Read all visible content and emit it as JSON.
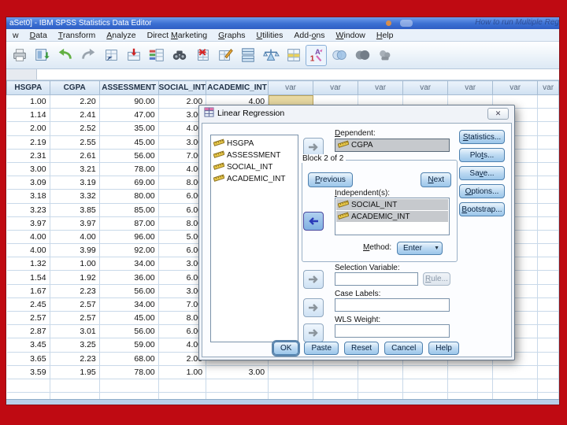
{
  "colors": {
    "frame_red": "#bf0a12",
    "titlebar_blue": "#3a6fd2",
    "selection_yellow": "#e8d9a2",
    "button_blue": "#bcd9f2",
    "selected_item_gray": "#c6c9cd"
  },
  "window": {
    "title": "aSet0] - IBM SPSS Statistics Data Editor",
    "titlebar_overlay": "How to run Multiple Reg",
    "menus": [
      {
        "label": "w"
      },
      {
        "label": "Data",
        "u": 0
      },
      {
        "label": "Transform",
        "u": 0
      },
      {
        "label": "Analyze",
        "u": 0
      },
      {
        "label": "Direct Marketing",
        "u": 7
      },
      {
        "label": "Graphs",
        "u": 0
      },
      {
        "label": "Utilities",
        "u": 0
      },
      {
        "label": "Add-ons",
        "u": 4
      },
      {
        "label": "Window",
        "u": 0
      },
      {
        "label": "Help",
        "u": 0
      }
    ]
  },
  "toolbar": {
    "icons": [
      "print",
      "open-recent-dialogs",
      "undo",
      "redo",
      "goto-case",
      "goto-variable",
      "variables",
      "find",
      "insert-cases",
      "insert-variable",
      "split-file",
      "weight-cases",
      "value-labels",
      "use-variable-sets",
      "show-variable-sets",
      "show-all-variables",
      "spell-check"
    ]
  },
  "grid": {
    "columns": [
      "HSGPA",
      "CGPA",
      "ASSESSMENT",
      "SOCIAL_INT",
      "ACADEMIC_INT",
      "var",
      "var",
      "var",
      "var",
      "var",
      "var",
      "var"
    ],
    "selection": {
      "row": 1,
      "column": 6
    },
    "rows": [
      [
        "1.00",
        "2.20",
        "90.00",
        "2.00",
        "4.00"
      ],
      [
        "1.14",
        "2.41",
        "47.00",
        "3.00",
        ""
      ],
      [
        "2.00",
        "2.52",
        "35.00",
        "4.00",
        ""
      ],
      [
        "2.19",
        "2.55",
        "45.00",
        "3.00",
        ""
      ],
      [
        "2.31",
        "2.61",
        "56.00",
        "7.00",
        ""
      ],
      [
        "3.00",
        "3.21",
        "78.00",
        "4.00",
        ""
      ],
      [
        "3.09",
        "3.19",
        "69.00",
        "8.00",
        ""
      ],
      [
        "3.18",
        "3.32",
        "80.00",
        "6.00",
        ""
      ],
      [
        "3.23",
        "3.85",
        "85.00",
        "6.00",
        ""
      ],
      [
        "3.97",
        "3.97",
        "87.00",
        "8.00",
        ""
      ],
      [
        "4.00",
        "4.00",
        "96.00",
        "5.00",
        ""
      ],
      [
        "4.00",
        "3.99",
        "92.00",
        "6.00",
        ""
      ],
      [
        "1.32",
        "1.00",
        "34.00",
        "3.00",
        ""
      ],
      [
        "1.54",
        "1.92",
        "36.00",
        "6.00",
        ""
      ],
      [
        "1.67",
        "2.23",
        "56.00",
        "3.00",
        ""
      ],
      [
        "2.45",
        "2.57",
        "34.00",
        "7.00",
        ""
      ],
      [
        "2.57",
        "2.57",
        "45.00",
        "8.00",
        ""
      ],
      [
        "2.87",
        "3.01",
        "56.00",
        "6.00",
        ""
      ],
      [
        "3.45",
        "3.25",
        "59.00",
        "4.00",
        ""
      ],
      [
        "3.65",
        "2.23",
        "68.00",
        "2.00",
        ""
      ],
      [
        "3.59",
        "1.95",
        "78.00",
        "1.00",
        "3.00"
      ]
    ]
  },
  "dialog": {
    "title": "Linear Regression",
    "close_glyph": "✕",
    "variables": [
      "HSGPA",
      "ASSESSMENT",
      "SOCIAL_INT",
      "ACADEMIC_INT"
    ],
    "dependent_label": "Dependent:",
    "dependent_value": "CGPA",
    "block_label": "Block 2 of 2",
    "previous_button": "Previous",
    "next_button": "Next",
    "independents_label": "Independent(s):",
    "independents": [
      "SOCIAL_INT",
      "ACADEMIC_INT"
    ],
    "method_label": "Method:",
    "method_value": "Enter",
    "selection_variable_label": "Selection Variable:",
    "selection_variable_value": "",
    "rule_button": "Rule...",
    "case_labels_label": "Case Labels:",
    "case_labels_value": "",
    "wls_weight_label": "WLS Weight:",
    "wls_weight_value": "",
    "side_buttons": [
      {
        "label": "Statistics...",
        "u": 0
      },
      {
        "label": "Plots...",
        "u": 3
      },
      {
        "label": "Save...",
        "u": 2
      },
      {
        "label": "Options...",
        "u": 0
      },
      {
        "label": "Bootstrap...",
        "u": 0
      }
    ],
    "bottom_buttons": [
      {
        "label": "OK",
        "cls": "focused"
      },
      {
        "label": "Paste"
      },
      {
        "label": "Reset"
      },
      {
        "label": "Cancel"
      },
      {
        "label": "Help"
      }
    ]
  }
}
